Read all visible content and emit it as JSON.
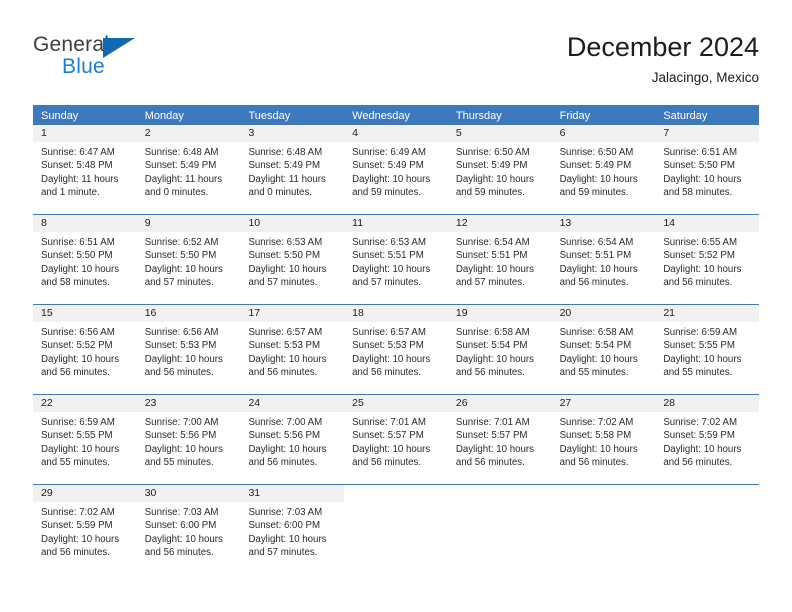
{
  "brand": {
    "name_top": "General",
    "name_bottom": "Blue",
    "accent_color": "#1a7fd4",
    "triangle_color": "#1268b3"
  },
  "header": {
    "title": "December 2024",
    "subtitle": "Jalacingo, Mexico"
  },
  "theme": {
    "header_blue": "#3d79bc",
    "daynum_band": "#f1f1f1",
    "text": "#1c1c1c"
  },
  "weekdays": [
    "Sunday",
    "Monday",
    "Tuesday",
    "Wednesday",
    "Thursday",
    "Friday",
    "Saturday"
  ],
  "weeks": [
    [
      {
        "day": "1",
        "sunrise": "Sunrise: 6:47 AM",
        "sunset": "Sunset: 5:48 PM",
        "daylight": "Daylight: 11 hours and 1 minute."
      },
      {
        "day": "2",
        "sunrise": "Sunrise: 6:48 AM",
        "sunset": "Sunset: 5:49 PM",
        "daylight": "Daylight: 11 hours and 0 minutes."
      },
      {
        "day": "3",
        "sunrise": "Sunrise: 6:48 AM",
        "sunset": "Sunset: 5:49 PM",
        "daylight": "Daylight: 11 hours and 0 minutes."
      },
      {
        "day": "4",
        "sunrise": "Sunrise: 6:49 AM",
        "sunset": "Sunset: 5:49 PM",
        "daylight": "Daylight: 10 hours and 59 minutes."
      },
      {
        "day": "5",
        "sunrise": "Sunrise: 6:50 AM",
        "sunset": "Sunset: 5:49 PM",
        "daylight": "Daylight: 10 hours and 59 minutes."
      },
      {
        "day": "6",
        "sunrise": "Sunrise: 6:50 AM",
        "sunset": "Sunset: 5:49 PM",
        "daylight": "Daylight: 10 hours and 59 minutes."
      },
      {
        "day": "7",
        "sunrise": "Sunrise: 6:51 AM",
        "sunset": "Sunset: 5:50 PM",
        "daylight": "Daylight: 10 hours and 58 minutes."
      }
    ],
    [
      {
        "day": "8",
        "sunrise": "Sunrise: 6:51 AM",
        "sunset": "Sunset: 5:50 PM",
        "daylight": "Daylight: 10 hours and 58 minutes."
      },
      {
        "day": "9",
        "sunrise": "Sunrise: 6:52 AM",
        "sunset": "Sunset: 5:50 PM",
        "daylight": "Daylight: 10 hours and 57 minutes."
      },
      {
        "day": "10",
        "sunrise": "Sunrise: 6:53 AM",
        "sunset": "Sunset: 5:50 PM",
        "daylight": "Daylight: 10 hours and 57 minutes."
      },
      {
        "day": "11",
        "sunrise": "Sunrise: 6:53 AM",
        "sunset": "Sunset: 5:51 PM",
        "daylight": "Daylight: 10 hours and 57 minutes."
      },
      {
        "day": "12",
        "sunrise": "Sunrise: 6:54 AM",
        "sunset": "Sunset: 5:51 PM",
        "daylight": "Daylight: 10 hours and 57 minutes."
      },
      {
        "day": "13",
        "sunrise": "Sunrise: 6:54 AM",
        "sunset": "Sunset: 5:51 PM",
        "daylight": "Daylight: 10 hours and 56 minutes."
      },
      {
        "day": "14",
        "sunrise": "Sunrise: 6:55 AM",
        "sunset": "Sunset: 5:52 PM",
        "daylight": "Daylight: 10 hours and 56 minutes."
      }
    ],
    [
      {
        "day": "15",
        "sunrise": "Sunrise: 6:56 AM",
        "sunset": "Sunset: 5:52 PM",
        "daylight": "Daylight: 10 hours and 56 minutes."
      },
      {
        "day": "16",
        "sunrise": "Sunrise: 6:56 AM",
        "sunset": "Sunset: 5:53 PM",
        "daylight": "Daylight: 10 hours and 56 minutes."
      },
      {
        "day": "17",
        "sunrise": "Sunrise: 6:57 AM",
        "sunset": "Sunset: 5:53 PM",
        "daylight": "Daylight: 10 hours and 56 minutes."
      },
      {
        "day": "18",
        "sunrise": "Sunrise: 6:57 AM",
        "sunset": "Sunset: 5:53 PM",
        "daylight": "Daylight: 10 hours and 56 minutes."
      },
      {
        "day": "19",
        "sunrise": "Sunrise: 6:58 AM",
        "sunset": "Sunset: 5:54 PM",
        "daylight": "Daylight: 10 hours and 56 minutes."
      },
      {
        "day": "20",
        "sunrise": "Sunrise: 6:58 AM",
        "sunset": "Sunset: 5:54 PM",
        "daylight": "Daylight: 10 hours and 55 minutes."
      },
      {
        "day": "21",
        "sunrise": "Sunrise: 6:59 AM",
        "sunset": "Sunset: 5:55 PM",
        "daylight": "Daylight: 10 hours and 55 minutes."
      }
    ],
    [
      {
        "day": "22",
        "sunrise": "Sunrise: 6:59 AM",
        "sunset": "Sunset: 5:55 PM",
        "daylight": "Daylight: 10 hours and 55 minutes."
      },
      {
        "day": "23",
        "sunrise": "Sunrise: 7:00 AM",
        "sunset": "Sunset: 5:56 PM",
        "daylight": "Daylight: 10 hours and 55 minutes."
      },
      {
        "day": "24",
        "sunrise": "Sunrise: 7:00 AM",
        "sunset": "Sunset: 5:56 PM",
        "daylight": "Daylight: 10 hours and 56 minutes."
      },
      {
        "day": "25",
        "sunrise": "Sunrise: 7:01 AM",
        "sunset": "Sunset: 5:57 PM",
        "daylight": "Daylight: 10 hours and 56 minutes."
      },
      {
        "day": "26",
        "sunrise": "Sunrise: 7:01 AM",
        "sunset": "Sunset: 5:57 PM",
        "daylight": "Daylight: 10 hours and 56 minutes."
      },
      {
        "day": "27",
        "sunrise": "Sunrise: 7:02 AM",
        "sunset": "Sunset: 5:58 PM",
        "daylight": "Daylight: 10 hours and 56 minutes."
      },
      {
        "day": "28",
        "sunrise": "Sunrise: 7:02 AM",
        "sunset": "Sunset: 5:59 PM",
        "daylight": "Daylight: 10 hours and 56 minutes."
      }
    ],
    [
      {
        "day": "29",
        "sunrise": "Sunrise: 7:02 AM",
        "sunset": "Sunset: 5:59 PM",
        "daylight": "Daylight: 10 hours and 56 minutes."
      },
      {
        "day": "30",
        "sunrise": "Sunrise: 7:03 AM",
        "sunset": "Sunset: 6:00 PM",
        "daylight": "Daylight: 10 hours and 56 minutes."
      },
      {
        "day": "31",
        "sunrise": "Sunrise: 7:03 AM",
        "sunset": "Sunset: 6:00 PM",
        "daylight": "Daylight: 10 hours and 57 minutes."
      },
      {
        "day": "",
        "sunrise": "",
        "sunset": "",
        "daylight": ""
      },
      {
        "day": "",
        "sunrise": "",
        "sunset": "",
        "daylight": ""
      },
      {
        "day": "",
        "sunrise": "",
        "sunset": "",
        "daylight": ""
      },
      {
        "day": "",
        "sunrise": "",
        "sunset": "",
        "daylight": ""
      }
    ]
  ]
}
